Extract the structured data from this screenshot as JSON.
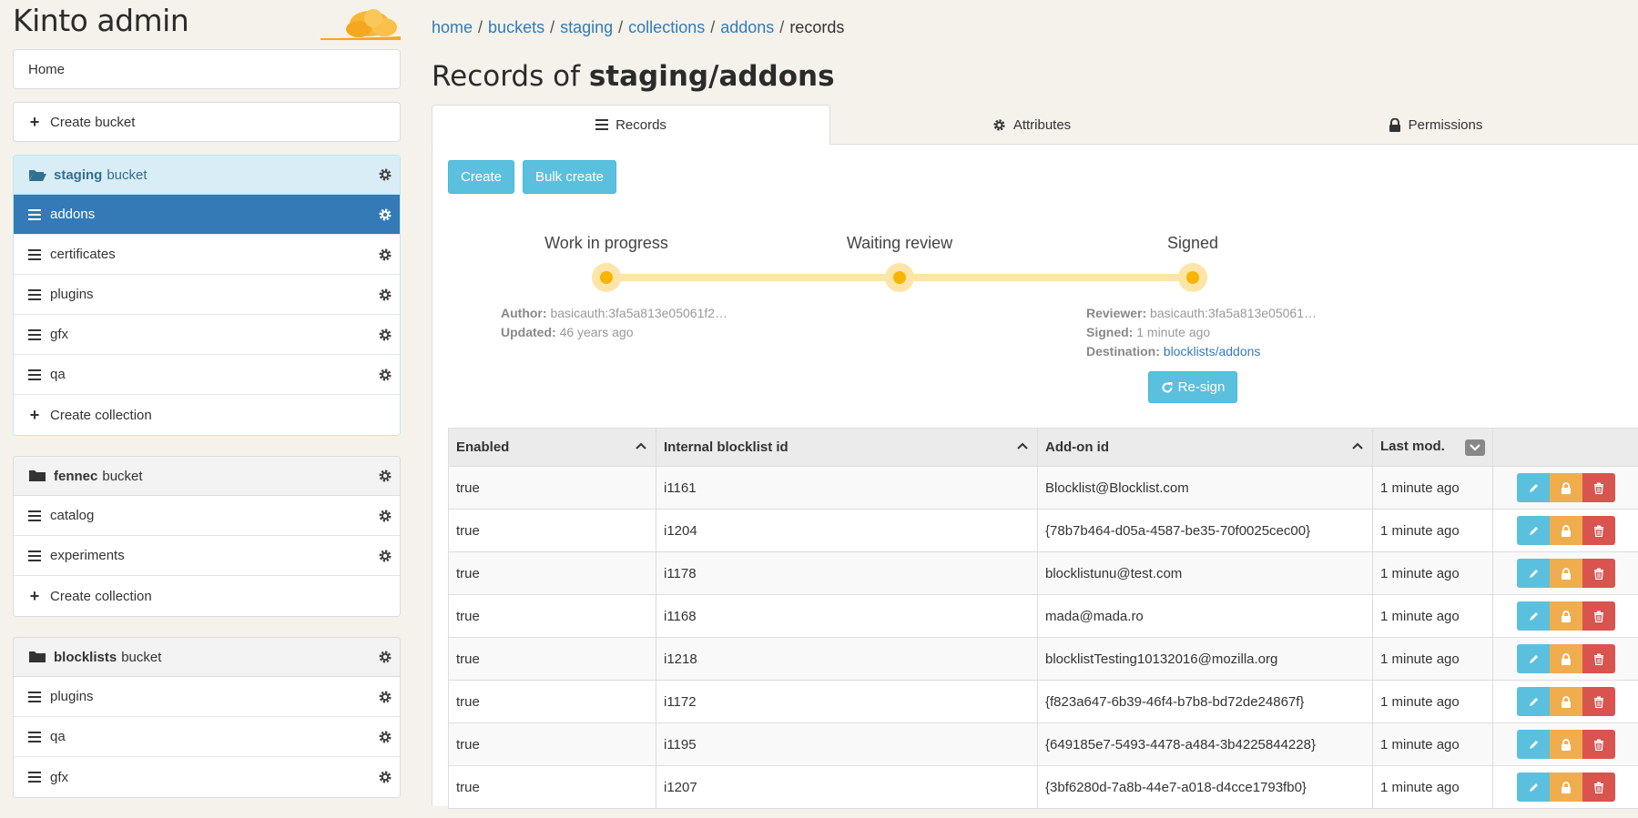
{
  "app": {
    "title": "Kinto admin"
  },
  "sidebar": {
    "home_label": "Home",
    "create_bucket_label": "Create bucket",
    "buckets": [
      {
        "name": "staging",
        "suffix": "bucket",
        "active": true,
        "collections": [
          "addons",
          "certificates",
          "plugins",
          "gfx",
          "qa"
        ],
        "active_collection": "addons",
        "create_collection_label": "Create collection"
      },
      {
        "name": "fennec",
        "suffix": "bucket",
        "active": false,
        "collections": [
          "catalog",
          "experiments"
        ],
        "create_collection_label": "Create collection"
      },
      {
        "name": "blocklists",
        "suffix": "bucket",
        "active": false,
        "collections": [
          "plugins",
          "qa",
          "gfx"
        ]
      }
    ]
  },
  "breadcrumb": {
    "items": [
      "home",
      "buckets",
      "staging",
      "collections",
      "addons"
    ],
    "current": "records",
    "separator": "/"
  },
  "page": {
    "title_prefix": "Records of",
    "title_path": "staging/addons"
  },
  "tabs": [
    {
      "label": "Records",
      "icon": "list-icon",
      "active": true
    },
    {
      "label": "Attributes",
      "icon": "gear-icon",
      "active": false
    },
    {
      "label": "Permissions",
      "icon": "lock-icon",
      "active": false
    }
  ],
  "toolbar": {
    "create_label": "Create",
    "bulk_create_label": "Bulk create"
  },
  "signoff": {
    "steps": [
      "Work in progress",
      "Waiting review",
      "Signed"
    ],
    "author_label": "Author:",
    "author_value": "basicauth:3fa5a813e05061f2…",
    "updated_label": "Updated:",
    "updated_value": "46 years ago",
    "reviewer_label": "Reviewer:",
    "reviewer_value": "basicauth:3fa5a813e05061…",
    "signed_label": "Signed:",
    "signed_value": "1 minute ago",
    "destination_label": "Destination:",
    "destination_value": "blocklists/addons",
    "resign_label": "Re-sign"
  },
  "table": {
    "columns": [
      "Enabled",
      "Internal blocklist id",
      "Add-on id",
      "Last mod."
    ],
    "rows": [
      [
        "true",
        "i1161",
        "Blocklist@Blocklist.com",
        "1 minute ago"
      ],
      [
        "true",
        "i1204",
        "{78b7b464-d05a-4587-be35-70f0025cec00}",
        "1 minute ago"
      ],
      [
        "true",
        "i1178",
        "blocklistunu@test.com",
        "1 minute ago"
      ],
      [
        "true",
        "i1168",
        "mada@mada.ro",
        "1 minute ago"
      ],
      [
        "true",
        "i1218",
        "blocklistTesting10132016@mozilla.org",
        "1 minute ago"
      ],
      [
        "true",
        "i1172",
        "{f823a647-6b39-46f4-b7b8-bd72de24867f}",
        "1 minute ago"
      ],
      [
        "true",
        "i1195",
        "{649185e7-5493-4478-a484-3b4225844228}",
        "1 minute ago"
      ],
      [
        "true",
        "i1207",
        "{3bf6280d-7a8b-44e7-a018-d4cce1793fb0}",
        "1 minute ago"
      ]
    ]
  },
  "colors": {
    "primary": "#337ab7",
    "info": "#5bc0de",
    "warning": "#f0ad4e",
    "danger": "#d9534f",
    "signoff_track": "#fde5a8",
    "signoff_dot": "#f7b500",
    "background": "#f5f2eb"
  }
}
